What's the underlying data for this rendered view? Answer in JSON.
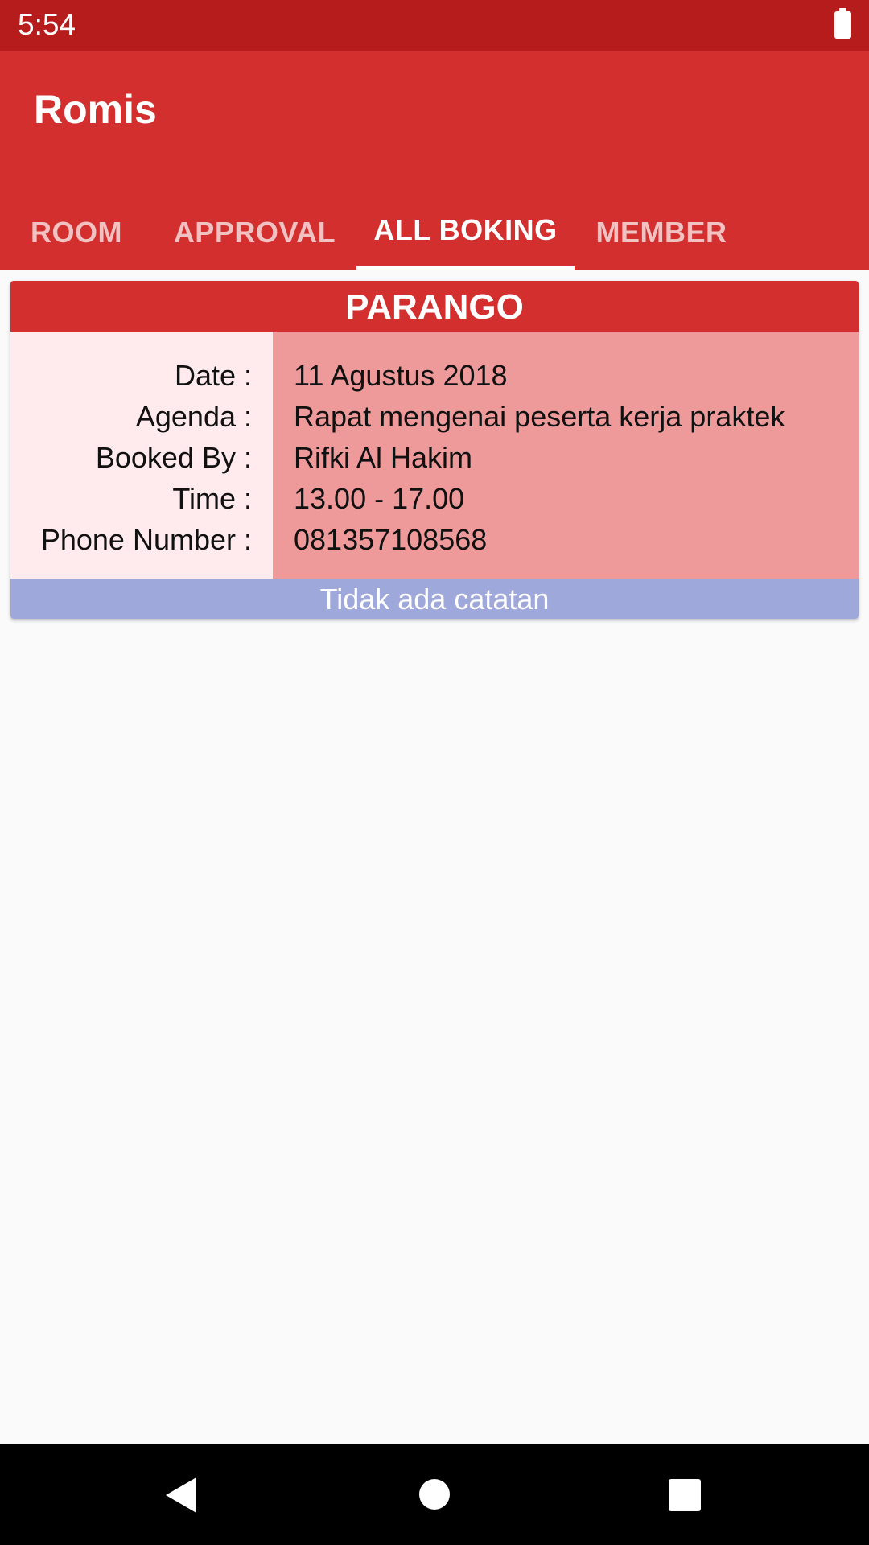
{
  "status_bar": {
    "time": "5:54"
  },
  "app": {
    "title": "Romis"
  },
  "tabs": [
    {
      "label": "ROOM",
      "active": false
    },
    {
      "label": "APPROVAL",
      "active": false
    },
    {
      "label": "ALL BOKING",
      "active": true
    },
    {
      "label": "MEMBER",
      "active": false
    }
  ],
  "booking": {
    "room": "PARANGO",
    "labels": {
      "date": "Date :",
      "agenda": "Agenda :",
      "booked_by": "Booked By :",
      "time": "Time :",
      "phone": "Phone Number :"
    },
    "values": {
      "date": "11 Agustus 2018",
      "agenda": "Rapat mengenai peserta kerja praktek",
      "booked_by": "Rifki Al Hakim",
      "time": "13.00 - 17.00",
      "phone": "081357108568"
    },
    "note": "Tidak ada catatan"
  },
  "colors": {
    "status_bar": "#b71c1c",
    "primary": "#d32f2f",
    "label_bg": "#ffebee",
    "value_bg": "#ef9a9a",
    "note_bg": "#9fa8da"
  },
  "icons": [
    "battery-icon",
    "back-icon",
    "home-icon",
    "recents-icon"
  ]
}
